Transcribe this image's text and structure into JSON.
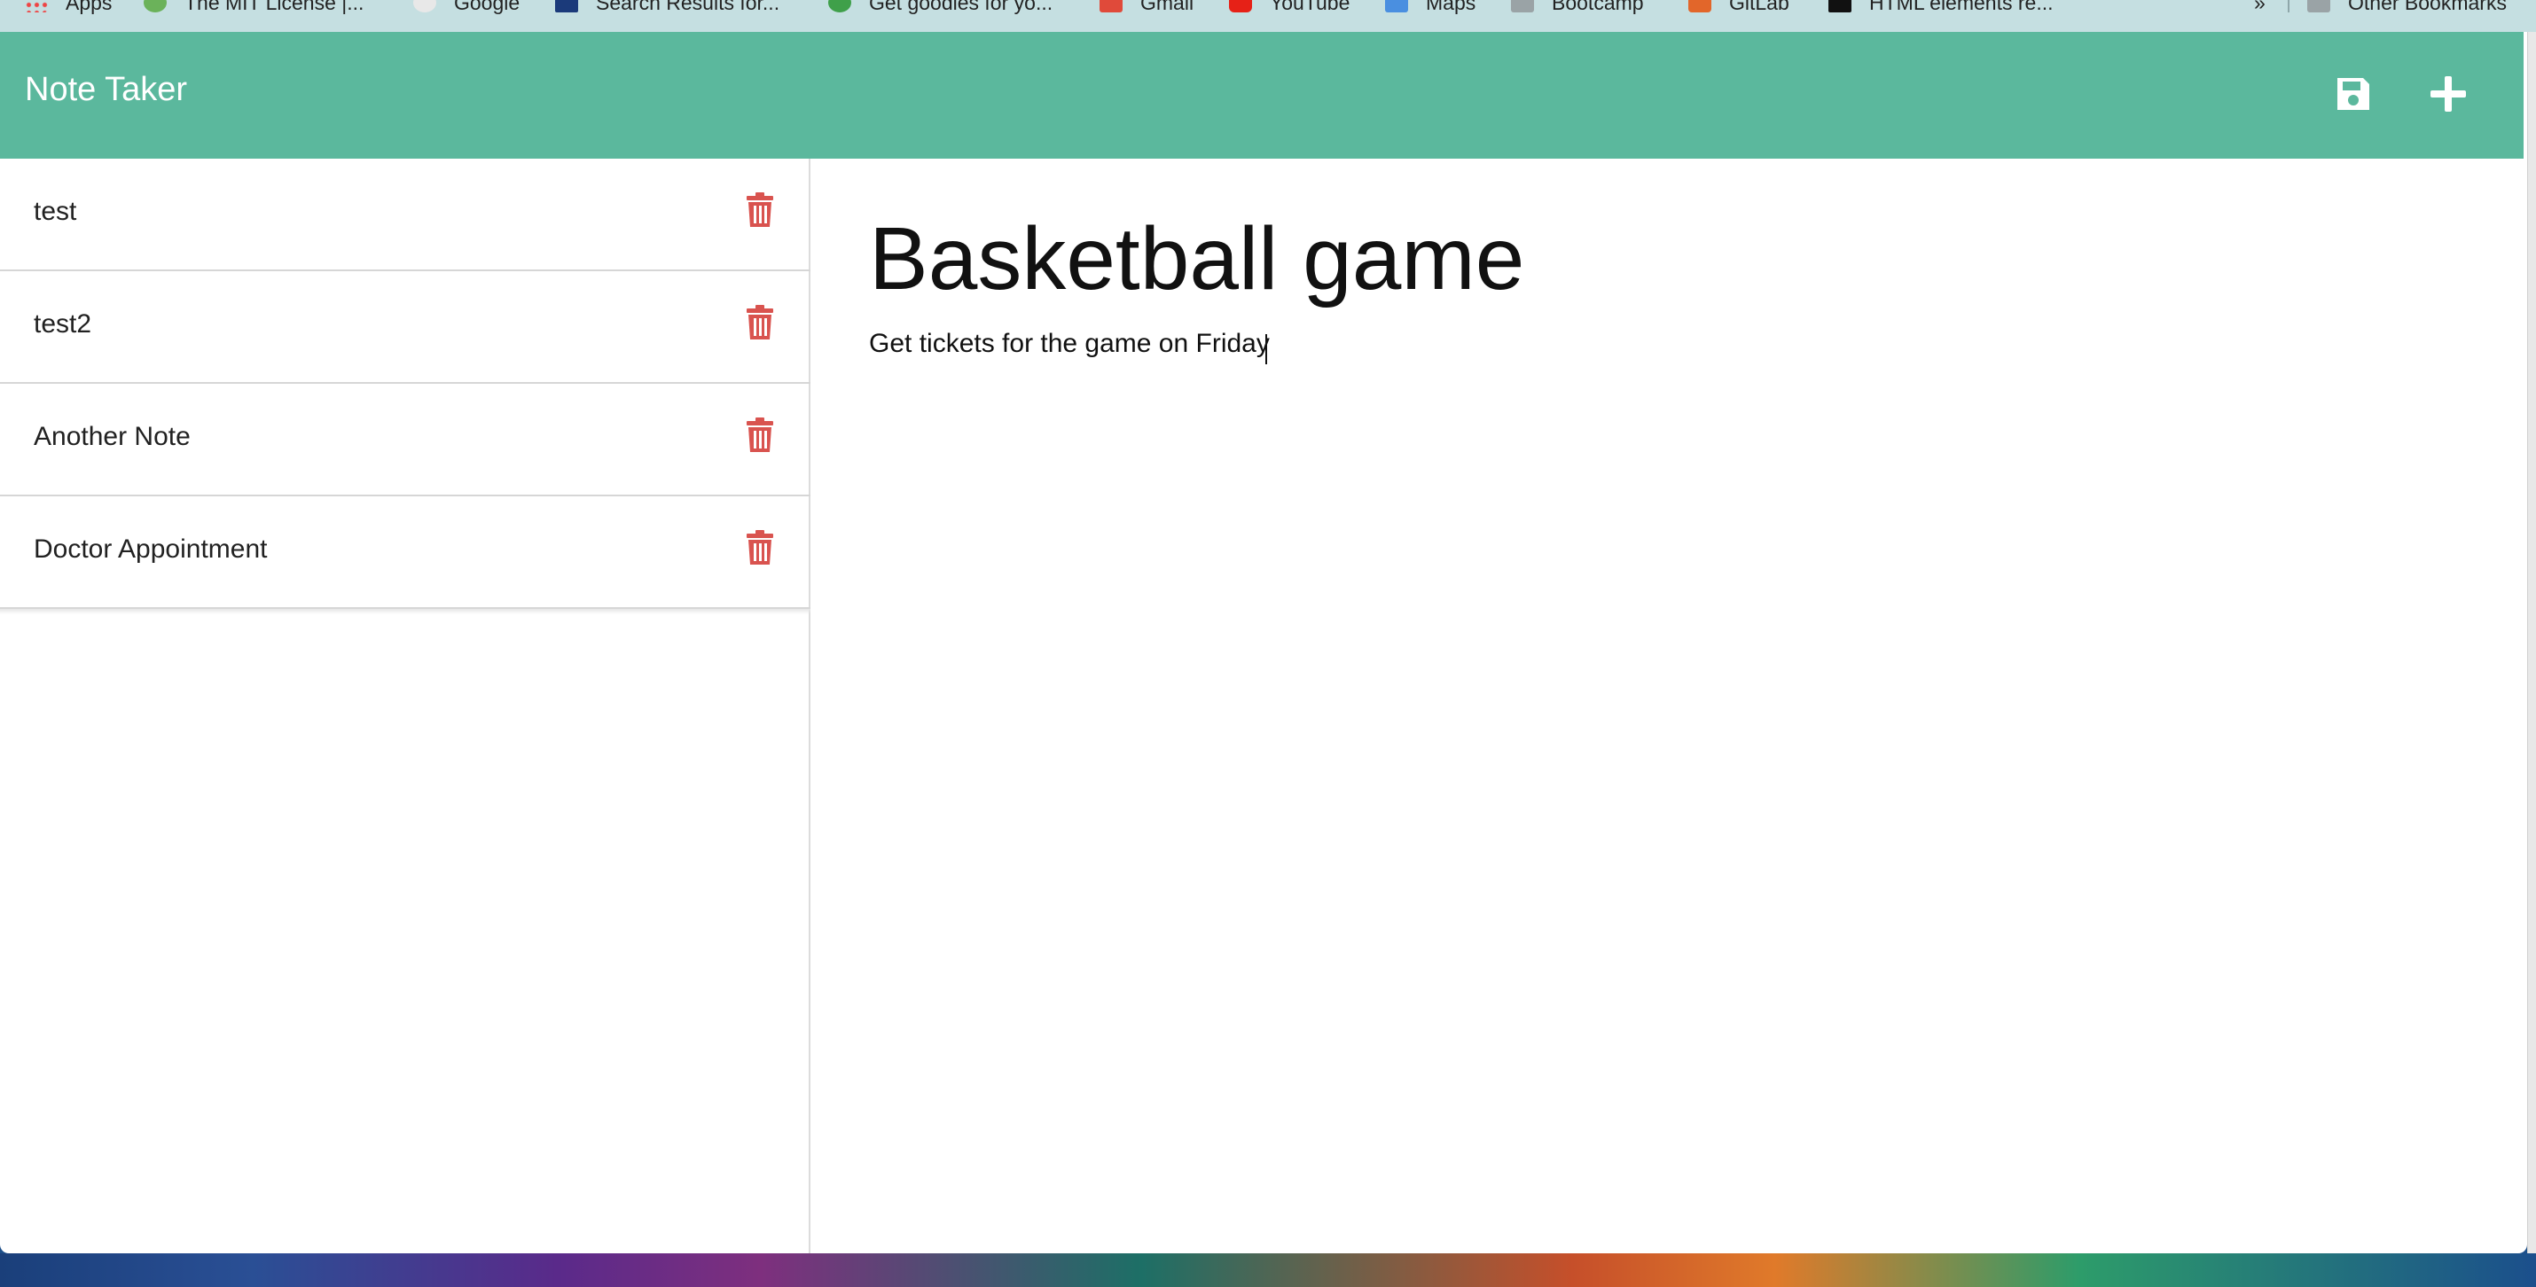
{
  "bookmarks": {
    "items": [
      {
        "label": "Apps"
      },
      {
        "label": "The MIT License |..."
      },
      {
        "label": "Google"
      },
      {
        "label": "Search Results for..."
      },
      {
        "label": "Get goodies for yo..."
      },
      {
        "label": "Gmail"
      },
      {
        "label": "YouTube"
      },
      {
        "label": "Maps"
      },
      {
        "label": "Bootcamp"
      },
      {
        "label": "GitLab"
      },
      {
        "label": "HTML elements re..."
      }
    ],
    "more": "»",
    "other": "Other Bookmarks"
  },
  "app": {
    "brand": "Note Taker",
    "icons": {
      "save": "save-icon",
      "new": "plus-icon",
      "delete": "trash-icon"
    },
    "colors": {
      "header": "#5bb89d",
      "delete": "#d9534f"
    }
  },
  "notes": [
    {
      "title": "test"
    },
    {
      "title": "test2"
    },
    {
      "title": "Another Note"
    },
    {
      "title": "Doctor Appointment"
    }
  ],
  "editor": {
    "title": "Basketball game",
    "text": "Get tickets for the game on Friday"
  }
}
